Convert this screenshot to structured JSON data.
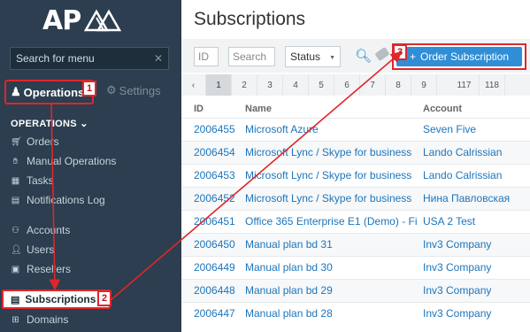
{
  "app": {
    "logo_text": "AP"
  },
  "sidebar": {
    "search_placeholder": "Search for menu",
    "tab_operations": "Operations",
    "tab_settings": "Settings",
    "section_title": "OPERATIONS",
    "items": [
      {
        "label": "Orders",
        "icon": "cart-icon"
      },
      {
        "label": "Manual Operations",
        "icon": "hand-icon"
      },
      {
        "label": "Tasks",
        "icon": "calendar-icon"
      },
      {
        "label": "Notifications Log",
        "icon": "log-icon"
      },
      {
        "label": "Accounts",
        "icon": "accounts-icon"
      },
      {
        "label": "Users",
        "icon": "user-icon"
      },
      {
        "label": "Resellers",
        "icon": "briefcase-icon"
      },
      {
        "label": "Subscriptions",
        "icon": "subscriptions-icon"
      },
      {
        "label": "Domains",
        "icon": "sitemap-icon"
      }
    ]
  },
  "annotations": {
    "badge1": "1",
    "badge2": "2",
    "badge3": "3"
  },
  "main": {
    "title": "Subscriptions",
    "filter_id_placeholder": "ID",
    "filter_search_placeholder": "Search",
    "status_label": "Status",
    "order_button": "Order Subscription",
    "pages": [
      "1",
      "2",
      "3",
      "4",
      "5",
      "6",
      "7",
      "8",
      "9",
      "117",
      "118"
    ],
    "columns": {
      "id": "ID",
      "name": "Name",
      "account": "Account"
    },
    "rows": [
      {
        "id": "2006455",
        "name": "Microsoft Azure",
        "account": "Seven Five"
      },
      {
        "id": "2006454",
        "name": "Microsoft Lync / Skype for business",
        "account": "Lando Calrissian"
      },
      {
        "id": "2006453",
        "name": "Microsoft Lync / Skype for business",
        "account": "Lando Calrissian"
      },
      {
        "id": "2006452",
        "name": "Microsoft Lync / Skype for business",
        "account": "Нина Павловская"
      },
      {
        "id": "2006451",
        "name": "Office 365 Enterprise E1 (Demo) - Fi",
        "account": "USA 2 Test"
      },
      {
        "id": "2006450",
        "name": "Manual plan bd 31",
        "account": "Inv3 Company"
      },
      {
        "id": "2006449",
        "name": "Manual plan bd 30",
        "account": "Inv3 Company"
      },
      {
        "id": "2006448",
        "name": "Manual plan bd 29",
        "account": "Inv3 Company"
      },
      {
        "id": "2006447",
        "name": "Manual plan bd 28",
        "account": "Inv3 Company"
      }
    ]
  },
  "colors": {
    "sidebar_bg": "#2c3e4f",
    "accent_blue": "#2f8ed6",
    "link_blue": "#1c75bc",
    "annotation_red": "#e0262b"
  }
}
